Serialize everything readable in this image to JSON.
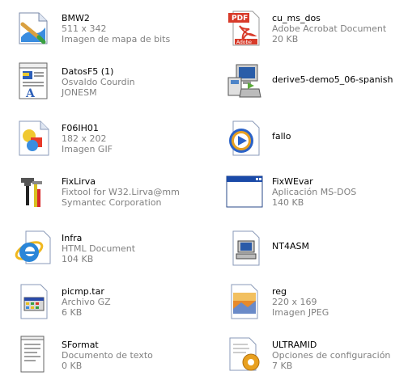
{
  "files": [
    {
      "name": "BMW2",
      "line2": "511 x 342",
      "line3": "Imagen de mapa de bits",
      "icon": "paint-bitmap-icon"
    },
    {
      "name": "cu_ms_dos",
      "line2": "Adobe Acrobat Document",
      "line3": "20 KB",
      "icon": "pdf-icon"
    },
    {
      "name": "DatosF5 (1)",
      "line2": "Osvaldo Courdin",
      "line3": "JONESM",
      "icon": "word-document-icon"
    },
    {
      "name": "derive5-demo5_06-spanish",
      "line2": "",
      "line3": "",
      "icon": "installer-icon"
    },
    {
      "name": "F06IH01",
      "line2": "182 x 202",
      "line3": "Imagen GIF",
      "icon": "gif-image-icon"
    },
    {
      "name": "fallo",
      "line2": "",
      "line3": "",
      "icon": "media-player-icon"
    },
    {
      "name": "FixLirva",
      "line2": "Fixtool for W32.Lirva@mm",
      "line3": "Symantec Corporation",
      "icon": "fixtool-icon"
    },
    {
      "name": "FixWEvar",
      "line2": "Aplicación MS-DOS",
      "line3": "140 KB",
      "icon": "msdos-window-icon"
    },
    {
      "name": "Infra",
      "line2": "HTML Document",
      "line3": "104 KB",
      "icon": "internet-explorer-icon"
    },
    {
      "name": "NT4ASM",
      "line2": "",
      "line3": "",
      "icon": "nt-asm-icon"
    },
    {
      "name": "picmp.tar",
      "line2": "Archivo GZ",
      "line3": "6 KB",
      "icon": "archive-icon"
    },
    {
      "name": "reg",
      "line2": "220 x 169",
      "line3": "Imagen JPEG",
      "icon": "jpeg-image-icon"
    },
    {
      "name": "SFormat",
      "line2": "Documento de texto",
      "line3": "0 KB",
      "icon": "text-document-icon"
    },
    {
      "name": "ULTRAMID",
      "line2": "Opciones de configuración",
      "line3": "7 KB",
      "icon": "config-settings-icon"
    }
  ]
}
